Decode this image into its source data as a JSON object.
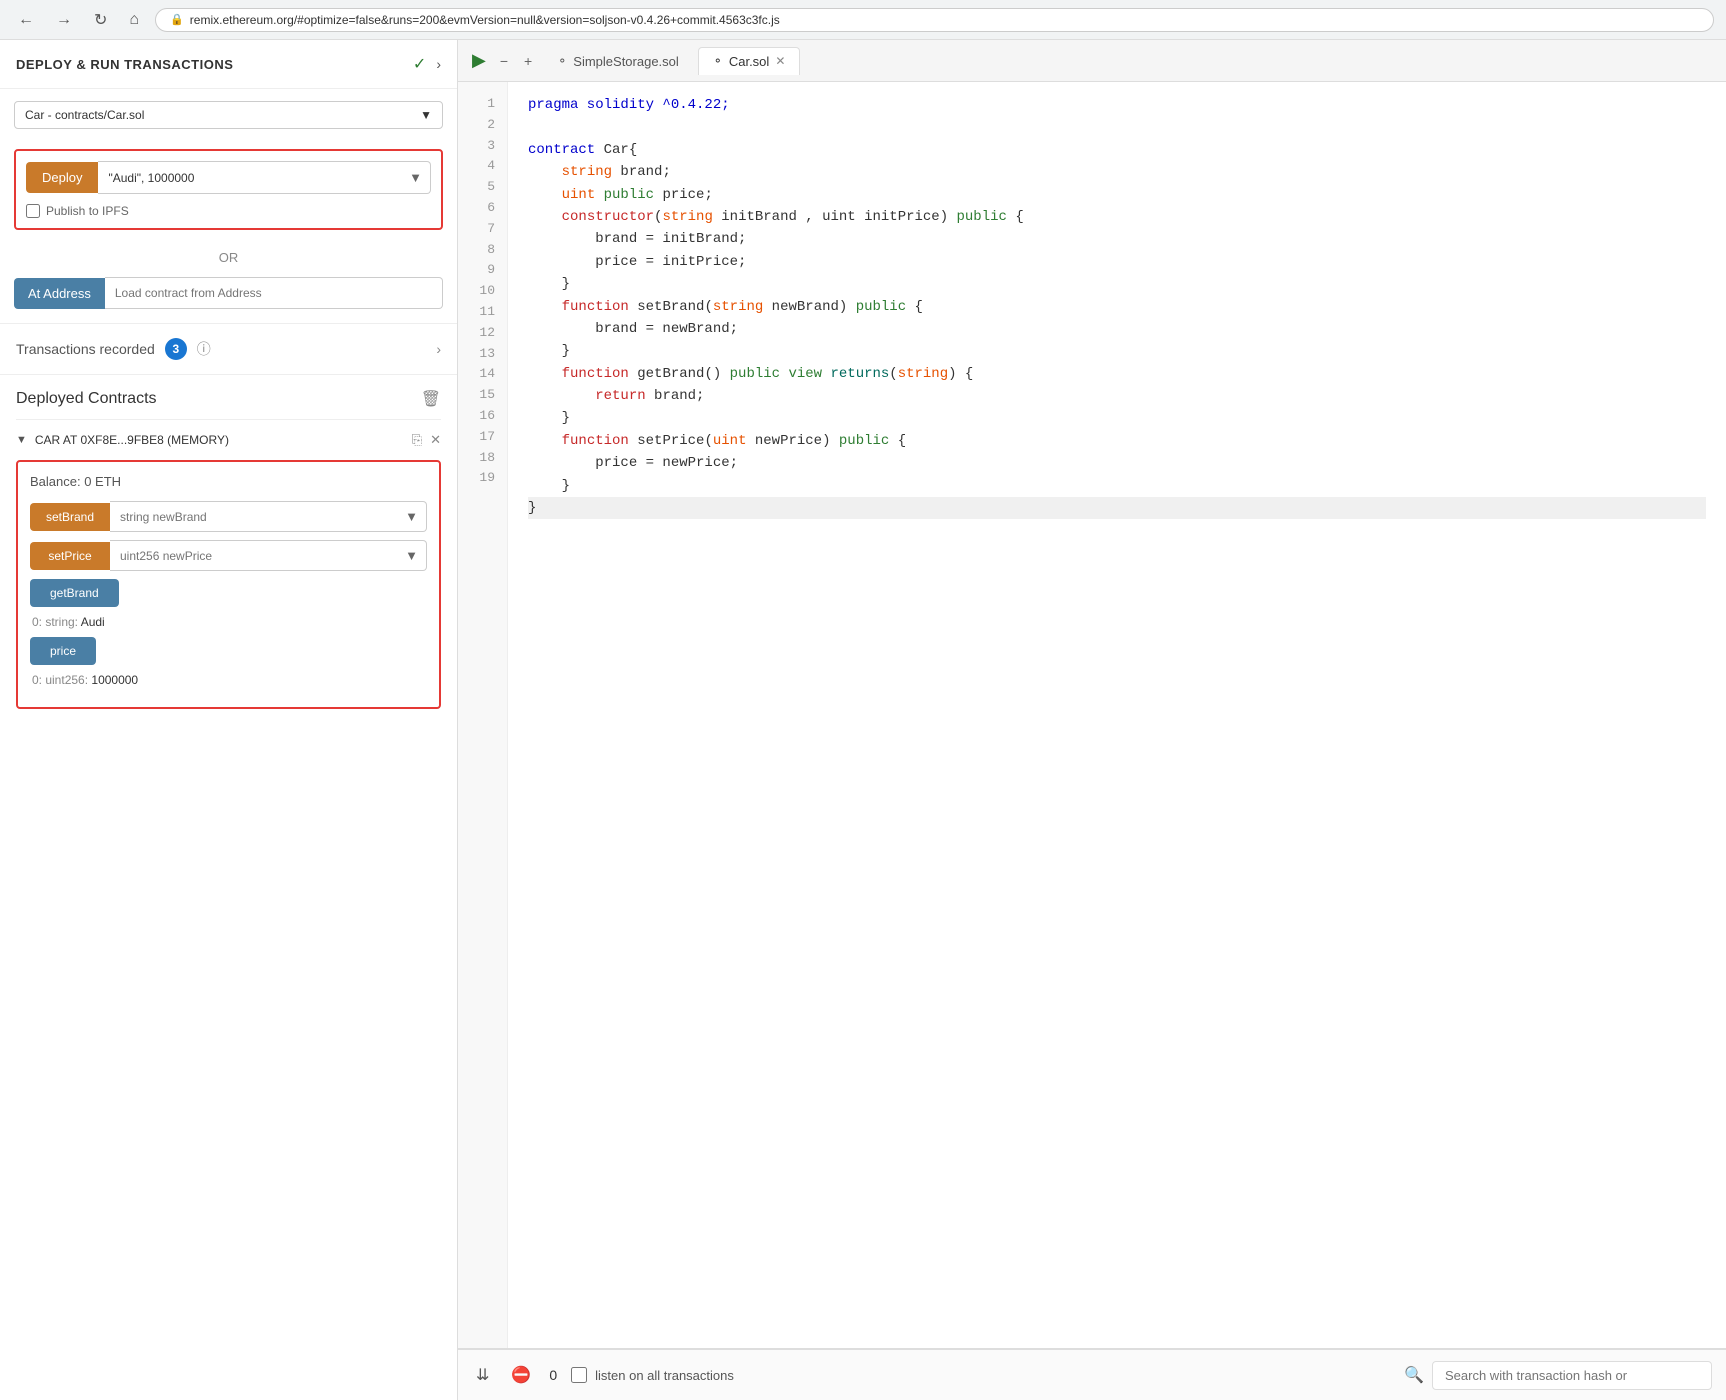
{
  "addressBar": {
    "url": "remix.ethereum.org/#optimize=false&runs=200&evmVersion=null&version=soljson-v0.4.26+commit.4563c3fc.js"
  },
  "leftPanel": {
    "title": "DEPLOY & RUN TRANSACTIONS",
    "contractSelector": {
      "value": "Car - contracts/Car.sol"
    },
    "deploy": {
      "buttonLabel": "Deploy",
      "inputValue": "\"Audi\", 1000000"
    },
    "publishIpfs": {
      "label": "Publish to IPFS"
    },
    "orLabel": "OR",
    "atAddress": {
      "buttonLabel": "At Address",
      "placeholder": "Load contract from Address"
    },
    "transactions": {
      "label": "Transactions recorded",
      "count": "3"
    },
    "deployedContracts": {
      "title": "Deployed Contracts",
      "instance": {
        "name": "CAR AT 0XF8E...9FBE8 (MEMORY)",
        "balance": "Balance: 0 ETH",
        "functions": [
          {
            "name": "setBrand",
            "type": "orange",
            "placeholder": "string newBrand",
            "hasDropdown": true
          },
          {
            "name": "setPrice",
            "type": "orange",
            "placeholder": "uint256 newPrice",
            "hasDropdown": true
          },
          {
            "name": "getBrand",
            "type": "blue",
            "result": "0:  string: Audi"
          },
          {
            "name": "price",
            "type": "blue",
            "result": "0:  uint256: 1000000"
          }
        ]
      }
    }
  },
  "editor": {
    "tabs": [
      {
        "label": "SimpleStorage.sol",
        "icon": "◎",
        "active": false,
        "closable": false
      },
      {
        "label": "Car.sol",
        "icon": "◎",
        "active": true,
        "closable": true
      }
    ],
    "lines": [
      {
        "num": 1,
        "tokens": [
          {
            "text": "pragma solidity ^0.4.22;",
            "class": "kw-blue"
          }
        ]
      },
      {
        "num": 2,
        "tokens": []
      },
      {
        "num": 3,
        "tokens": [
          {
            "text": "contract ",
            "class": "kw-blue"
          },
          {
            "text": "Car",
            "class": "plain"
          },
          {
            "text": "{",
            "class": "plain"
          }
        ]
      },
      {
        "num": 4,
        "tokens": [
          {
            "text": "    string ",
            "class": "kw-orange"
          },
          {
            "text": "brand;",
            "class": "plain"
          }
        ]
      },
      {
        "num": 5,
        "tokens": [
          {
            "text": "    uint ",
            "class": "kw-orange"
          },
          {
            "text": "public ",
            "class": "kw-green"
          },
          {
            "text": "price;",
            "class": "plain"
          }
        ]
      },
      {
        "num": 6,
        "tokens": [
          {
            "text": "    constructor",
            "class": "kw-red"
          },
          {
            "text": "(",
            "class": "plain"
          },
          {
            "text": "string ",
            "class": "kw-orange"
          },
          {
            "text": "initBrand , uint initPrice) ",
            "class": "plain"
          },
          {
            "text": "public",
            "class": "kw-green"
          },
          {
            "text": " {",
            "class": "plain"
          }
        ]
      },
      {
        "num": 7,
        "tokens": [
          {
            "text": "        brand = initBrand;",
            "class": "plain"
          }
        ]
      },
      {
        "num": 8,
        "tokens": [
          {
            "text": "        price = initPrice;",
            "class": "plain"
          }
        ]
      },
      {
        "num": 9,
        "tokens": [
          {
            "text": "    }",
            "class": "plain"
          }
        ]
      },
      {
        "num": 10,
        "tokens": [
          {
            "text": "    function ",
            "class": "kw-red"
          },
          {
            "text": "setBrand",
            "class": "plain"
          },
          {
            "text": "(",
            "class": "plain"
          },
          {
            "text": "string ",
            "class": "kw-orange"
          },
          {
            "text": "newBrand) ",
            "class": "plain"
          },
          {
            "text": "public",
            "class": "kw-green"
          },
          {
            "text": " {",
            "class": "plain"
          }
        ]
      },
      {
        "num": 11,
        "tokens": [
          {
            "text": "        brand = newBrand;",
            "class": "plain"
          }
        ]
      },
      {
        "num": 12,
        "tokens": [
          {
            "text": "    }",
            "class": "plain"
          }
        ]
      },
      {
        "num": 13,
        "tokens": [
          {
            "text": "    function ",
            "class": "kw-red"
          },
          {
            "text": "getBrand() ",
            "class": "plain"
          },
          {
            "text": "public view ",
            "class": "kw-green"
          },
          {
            "text": "returns",
            "class": "kw-teal"
          },
          {
            "text": "(",
            "class": "plain"
          },
          {
            "text": "string",
            "class": "kw-orange"
          },
          {
            "text": ") {",
            "class": "plain"
          }
        ]
      },
      {
        "num": 14,
        "tokens": [
          {
            "text": "        return ",
            "class": "kw-red"
          },
          {
            "text": "brand;",
            "class": "plain"
          }
        ]
      },
      {
        "num": 15,
        "tokens": [
          {
            "text": "    }",
            "class": "plain"
          }
        ]
      },
      {
        "num": 16,
        "tokens": [
          {
            "text": "    function ",
            "class": "kw-red"
          },
          {
            "text": "setPrice",
            "class": "plain"
          },
          {
            "text": "(",
            "class": "plain"
          },
          {
            "text": "uint ",
            "class": "kw-orange"
          },
          {
            "text": "newPrice) ",
            "class": "plain"
          },
          {
            "text": "public",
            "class": "kw-green"
          },
          {
            "text": " {",
            "class": "plain"
          }
        ]
      },
      {
        "num": 17,
        "tokens": [
          {
            "text": "        price = newPrice;",
            "class": "plain"
          }
        ]
      },
      {
        "num": 18,
        "tokens": [
          {
            "text": "    }",
            "class": "plain"
          }
        ]
      },
      {
        "num": 19,
        "tokens": [
          {
            "text": "}",
            "class": "plain"
          }
        ],
        "lastLine": true
      }
    ]
  },
  "bottomBar": {
    "count": "0",
    "listenLabel": "listen on all transactions",
    "searchPlaceholder": "Search with transaction hash or"
  }
}
